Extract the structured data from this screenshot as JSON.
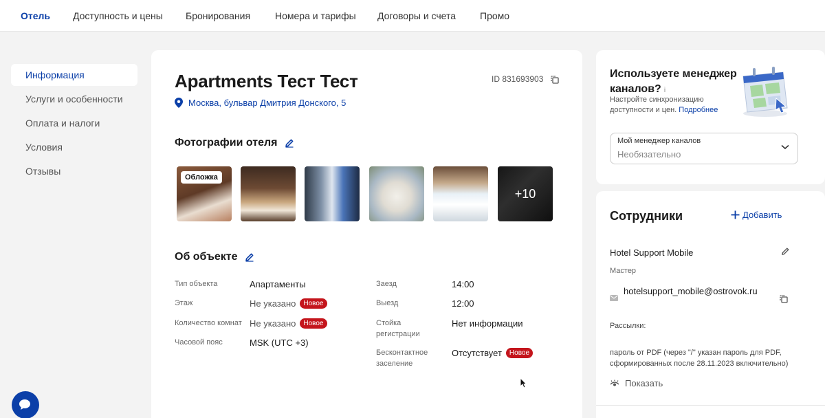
{
  "topnav": {
    "tabs": [
      {
        "label": "Отель",
        "active": true
      },
      {
        "label": "Доступность и цены"
      },
      {
        "label": "Бронирования"
      },
      {
        "label": "Номера и тарифы"
      },
      {
        "label": "Договоры и счета"
      },
      {
        "label": "Промо"
      }
    ]
  },
  "sidebar": {
    "items": [
      {
        "label": "Информация",
        "active": true
      },
      {
        "label": "Услуги и особенности"
      },
      {
        "label": "Оплата и налоги"
      },
      {
        "label": "Условия"
      },
      {
        "label": "Отзывы"
      }
    ]
  },
  "hotel": {
    "title": "Apartments Тест Тест",
    "id_label": "ID 831693903",
    "address": "Москва, бульвар Дмитрия Донского, 5"
  },
  "photos": {
    "title": "Фотографии отеля",
    "cover_label": "Обложка",
    "more_label": "+10"
  },
  "about": {
    "title": "Об объекте",
    "new_badge": "Новое",
    "left": [
      {
        "label": "Тип объекта",
        "value": "Апартаменты"
      },
      {
        "label": "Этаж",
        "value": "Не указано",
        "is_new": true
      },
      {
        "label": "Количество комнат",
        "value": "Не указано",
        "is_new": true
      },
      {
        "label": "Часовой пояс",
        "value": "MSK (UTC +3)"
      }
    ],
    "right": [
      {
        "label": "Заезд",
        "value": "14:00"
      },
      {
        "label": "Выезд",
        "value": "12:00"
      },
      {
        "label": "Стойка регистрации",
        "value": "Нет информации"
      },
      {
        "label": "Бесконтактное заселение",
        "value": "Отсутствует",
        "is_new": true
      }
    ]
  },
  "channel_manager": {
    "title": "Используете менеджер каналов?",
    "info_icon": "i",
    "desc": "Настройте синхронизацию доступности и цен.",
    "link": "Подробнее",
    "select_label": "Мой менеджер каналов",
    "select_placeholder": "Необязательно"
  },
  "staff": {
    "title": "Сотрудники",
    "add_label": "Добавить",
    "name": "Hotel Support Mobile",
    "role": "Мастер",
    "email": "hotelsupport_mobile@ostrovok.ru",
    "subs_label": "Рассылки:",
    "subs_text": "пароль от PDF (через \"/\" указан пароль для PDF, сформированных после 28.11.2023 включительно)",
    "show_label": "Показать"
  },
  "colors": {
    "accent": "#0b3fa8",
    "badge_red": "#c4151c",
    "background": "#f3f3f3"
  }
}
